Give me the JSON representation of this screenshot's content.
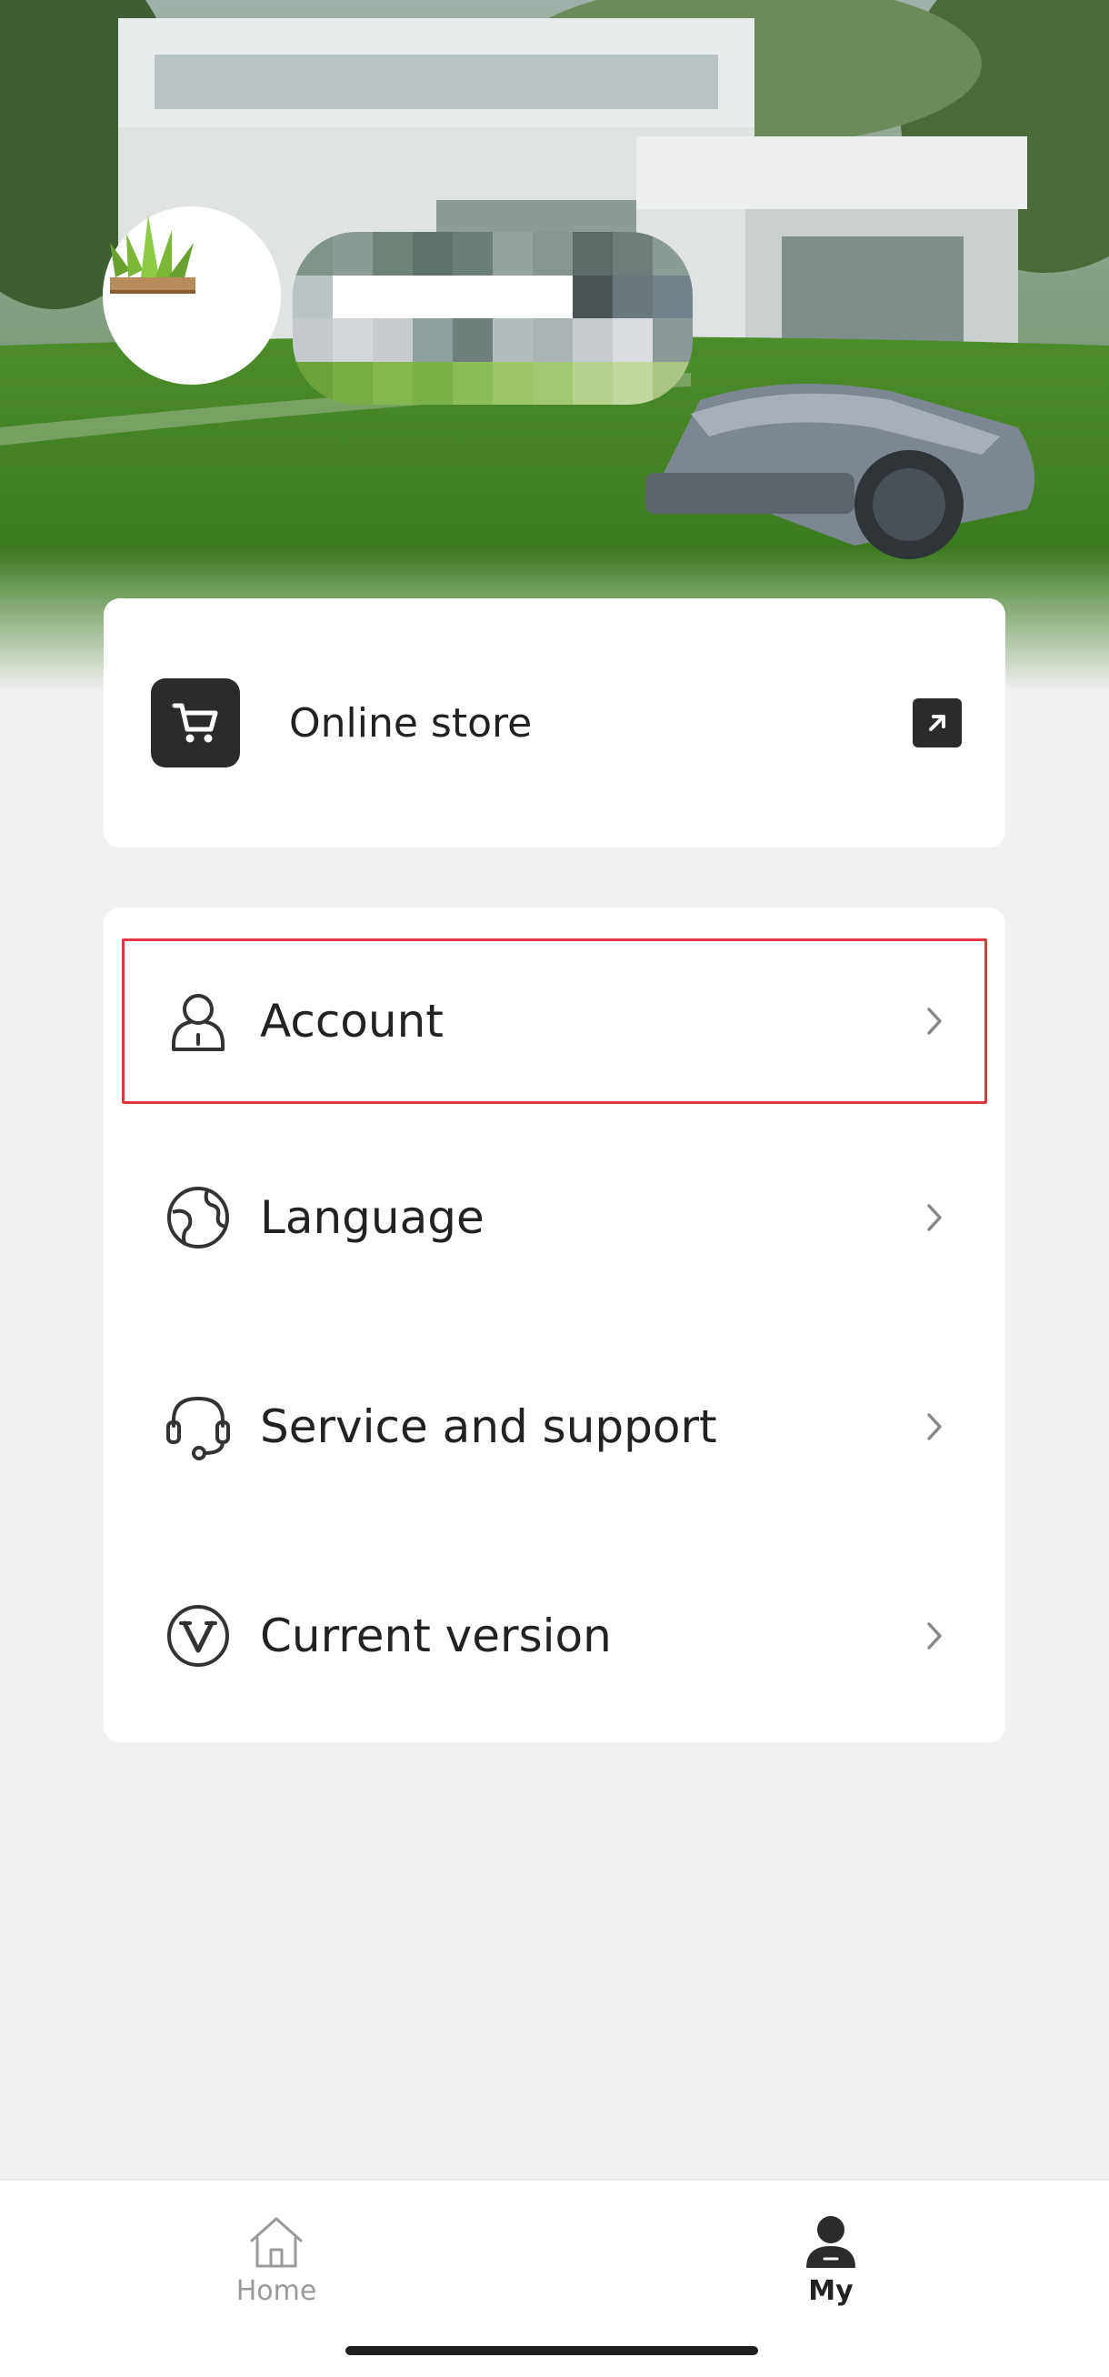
{
  "colors": {
    "background": "#f1f1f1",
    "card": "#ffffff",
    "icon_dark": "#2b2b2b",
    "highlight_outline": "#e0383e",
    "tab_inactive": "#9a9a9a",
    "tab_active": "#222222"
  },
  "profile": {
    "avatar_icon": "grass-icon",
    "username": ""
  },
  "store": {
    "icon": "shopping-cart-icon",
    "label": "Online store",
    "action_icon": "external-link-arrow-icon"
  },
  "menu": {
    "items": [
      {
        "label": "Account",
        "icon": "person-icon",
        "highlighted": true
      },
      {
        "label": "Language",
        "icon": "globe-icon",
        "highlighted": false
      },
      {
        "label": "Service and support",
        "icon": "headset-icon",
        "highlighted": false
      },
      {
        "label": "Current version",
        "icon": "version-v-icon",
        "highlighted": false
      }
    ]
  },
  "tabbar": {
    "tabs": [
      {
        "label": "Home",
        "icon": "home-icon",
        "active": false
      },
      {
        "label": "My",
        "icon": "user-icon",
        "active": true
      }
    ]
  }
}
